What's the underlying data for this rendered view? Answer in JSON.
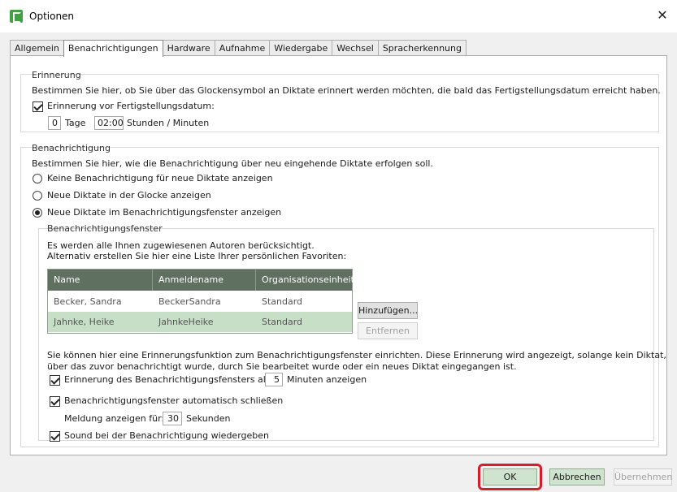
{
  "window": {
    "title": "Optionen"
  },
  "tabs": [
    "Allgemein",
    "Benachrichtigungen",
    "Hardware",
    "Aufnahme",
    "Wiedergabe",
    "Wechsel",
    "Spracherkennung"
  ],
  "erinnerung": {
    "title": "Erinnerung",
    "description": "Bestimmen Sie hier, ob Sie über das Glockensymbol an Diktate erinnert werden möchten, die bald das Fertigstellungsdatum erreicht haben.",
    "checkbox_label": "Erinnerung vor Fertigstellungsdatum:",
    "days_value": "0",
    "days_label": "Tage",
    "time_value": "02:00",
    "time_label": "Stunden / Minuten"
  },
  "benachrichtigung": {
    "title": "Benachrichtigung",
    "description": "Bestimmen Sie hier, wie die Benachrichtigung über neu eingehende Diktate erfolgen soll.",
    "options": [
      "Keine Benachrichtigung für neue Diktate anzeigen",
      "Neue Diktate in der Glocke anzeigen",
      "Neue Diktate im Benachrichtigungsfenster anzeigen"
    ],
    "selected_option": "Neue Diktate im Benachrichtigungsfenster anzeigen"
  },
  "fenster": {
    "title": "Benachrichtigungsfenster",
    "info_line1": "Es werden alle Ihnen zugewiesenen Autoren berücksichtigt.",
    "info_line2": "Alternativ erstellen Sie hier eine Liste Ihrer persönlichen Favoriten:",
    "columns": [
      "Name",
      "Anmeldename",
      "Organisationseinheit"
    ],
    "rows": [
      {
        "name": "Becker, Sandra",
        "login": "BeckerSandra",
        "unit": "Standard"
      },
      {
        "name": "Jahnke, Heike",
        "login": "JahnkeHeike",
        "unit": "Standard"
      }
    ],
    "add_button": "Hinzufügen...",
    "remove_button": "Entfernen",
    "reminder_text1": "Sie können hier eine Erinnerungsfunktion zum Benachrichtigungsfenster einrichten. Diese Erinnerung wird angezeigt, solange kein Diktat,",
    "reminder_text2": "über das zuvor benachrichtigt wurde, durch Sie bearbeitet wurde oder ein neues Diktat eingegangen ist.",
    "reminder_label_before": "Erinnerung des Benachrichtigungsfensters alle",
    "reminder_minutes": "5",
    "reminder_label_after": "Minuten  anzeigen",
    "autoclose_label": "Benachrichtigungsfenster automatisch schließen",
    "message_label": "Meldung anzeigen für:",
    "message_seconds": "30",
    "message_unit": "Sekunden",
    "sound_label": "Sound bei der Benachrichtigung wiedergeben"
  },
  "footer": {
    "ok": "OK",
    "cancel": "Abbrechen",
    "apply": "Übernehmen"
  },
  "colors": {
    "accent": "#43a047",
    "grid_header": "#5f6f60",
    "selected_row": "#c7dfc7",
    "highlight_ring": "#d21f2b"
  }
}
